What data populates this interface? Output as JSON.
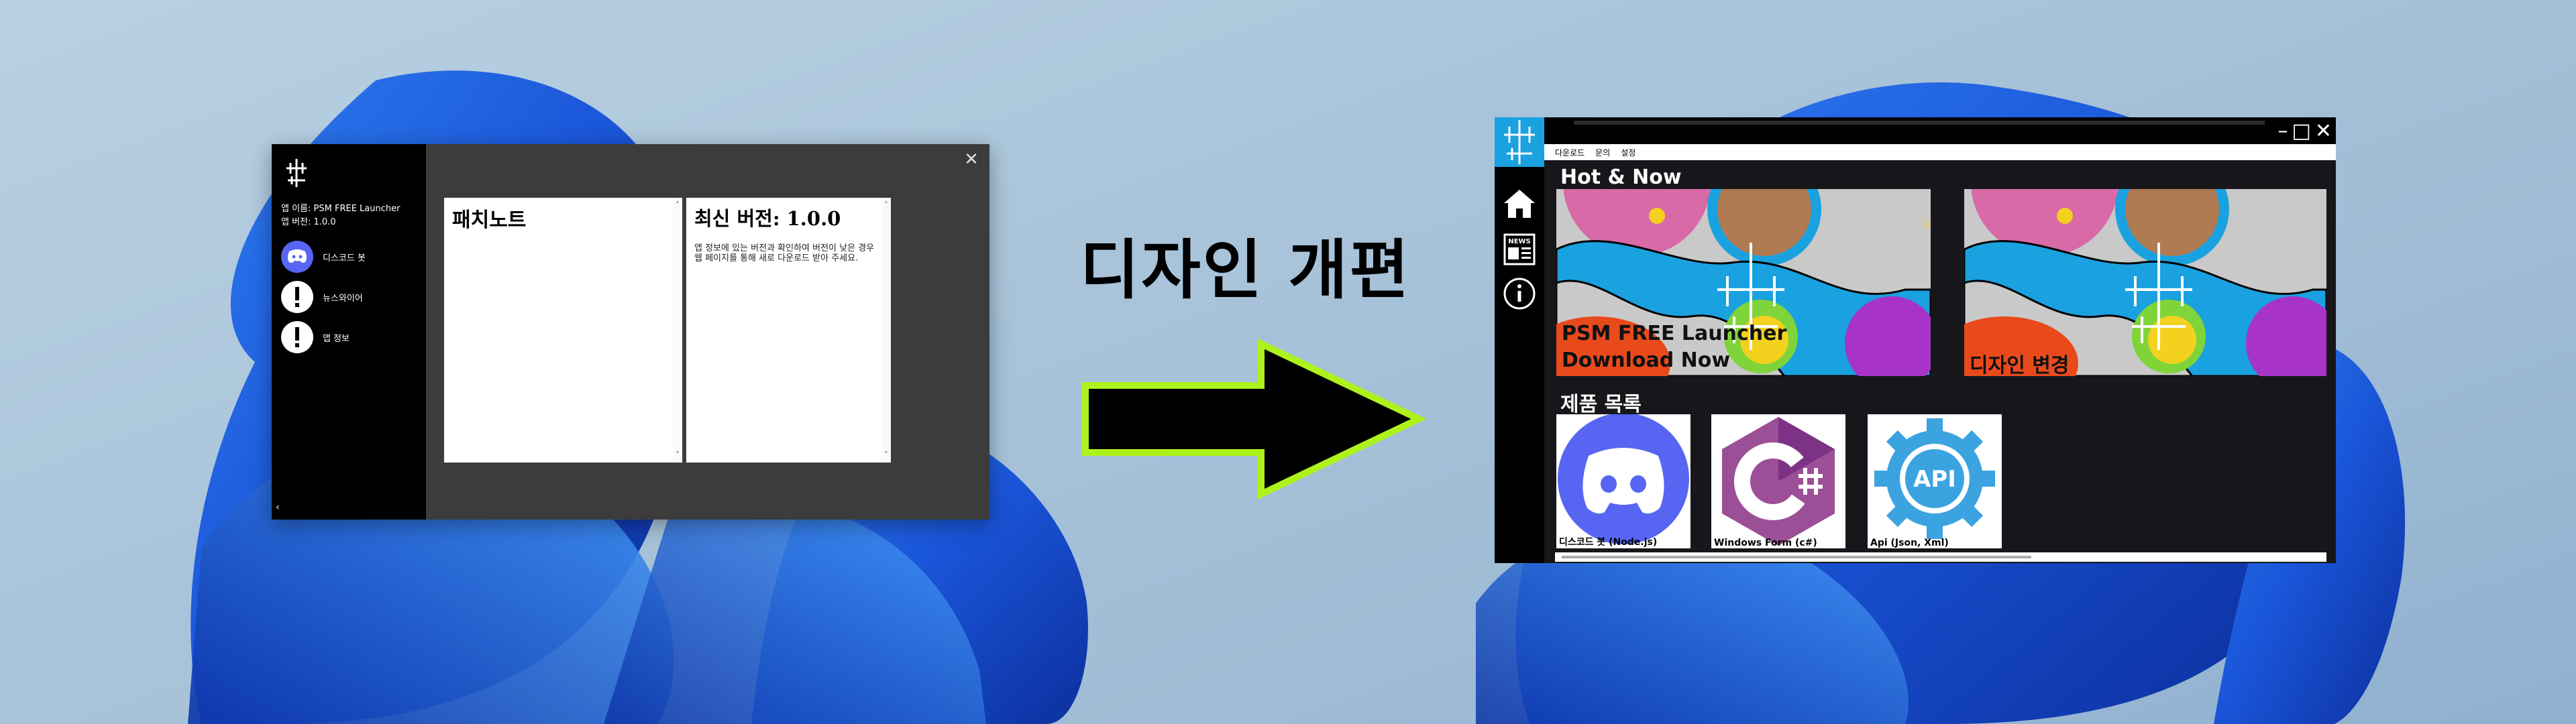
{
  "headline": "디자인 개편",
  "old_launcher": {
    "app_name": "앱 이름: PSM FREE Launcher",
    "app_version": "앱 버전: 1.0.0",
    "nav": [
      {
        "label": "디스코드 봇",
        "icon": "discord-icon"
      },
      {
        "label": "뉴스와이어",
        "icon": "alert-icon"
      },
      {
        "label": "앱 정보",
        "icon": "alert-icon"
      }
    ],
    "back_glyph": "‹",
    "close_glyph": "✕",
    "patch_notes_title": "패치노트",
    "latest_version_title": "최신 버전: 1.0.0",
    "latest_version_text": "앱 정보에 있는 버전과 확인하여 버전이 낮은 경우 웹 페이지를 통해 새로 다운로드 받아 주세요.",
    "scroll_up": "˄",
    "scroll_down": "˅"
  },
  "new_launcher": {
    "menu": [
      "다운로드",
      "문의",
      "설정"
    ],
    "window_controls": [
      "–",
      "□",
      "✕"
    ],
    "hot_title": "Hot & Now",
    "banners": [
      {
        "line1": "PSM FREE Launcher",
        "line2": "Download Now"
      },
      {
        "line1": "디자인 변경"
      }
    ],
    "products_title": "제품 목록",
    "products": [
      {
        "label": "디스코드 봇 (Node.js)",
        "icon": "discord-icon",
        "color": "#5865F2"
      },
      {
        "label": "Windows Form (c#)",
        "icon": "csharp-icon",
        "color": "#9B4F96"
      },
      {
        "label": "Api (Json, Xml)",
        "icon": "api-gear-icon",
        "color": "#3ba3e0",
        "icon_text": "API"
      }
    ],
    "side_icons": [
      "home-icon",
      "news-icon",
      "info-icon"
    ],
    "news_icon_text": "NEWS"
  },
  "colors": {
    "accent": "#1aa1e0",
    "arrow_outline": "#aef21c",
    "discord": "#5865F2"
  }
}
